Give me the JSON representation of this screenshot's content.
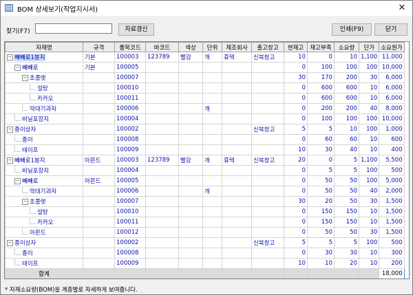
{
  "window": {
    "title": "BOM 상세보기(작업지시서)",
    "close_label": "✕"
  },
  "toolbar": {
    "find_label": "찾기(F7)",
    "search_value": "",
    "refresh_label": "자료갱신",
    "print_label": "인쇄(F9)",
    "close_label": "닫기"
  },
  "grid": {
    "columns": [
      "자재명",
      "규격",
      "품목코드",
      "바코드",
      "색상",
      "단위",
      "제조회사",
      "출고창고",
      "현재고",
      "재고부족",
      "소요량",
      "단가",
      "소요원가"
    ],
    "rows": [
      {
        "depth": 0,
        "exp": "-",
        "name": "빼빼로1봉지",
        "spec": "기본",
        "code": "100003",
        "barcode": "123789",
        "color": "빨강",
        "unit": "개",
        "maker": "휴텍",
        "warehouse": "신북창고",
        "stock": "10",
        "short": "0",
        "qty": "10",
        "price": "1,100",
        "cost": "11,000",
        "sel": true
      },
      {
        "depth": 1,
        "exp": "-",
        "name": "빼빼로",
        "spec": "기본",
        "code": "100005",
        "barcode": "",
        "color": "",
        "unit": "",
        "maker": "",
        "warehouse": "",
        "stock": "0",
        "short": "100",
        "qty": "100",
        "price": "100",
        "cost": "10,000"
      },
      {
        "depth": 2,
        "exp": "-",
        "name": "초콜렛",
        "spec": "",
        "code": "100007",
        "barcode": "",
        "color": "",
        "unit": "",
        "maker": "",
        "warehouse": "",
        "stock": "30",
        "short": "170",
        "qty": "200",
        "price": "30",
        "cost": "6,000"
      },
      {
        "depth": 3,
        "exp": "",
        "name": "설탕",
        "spec": "",
        "code": "100010",
        "barcode": "",
        "color": "",
        "unit": "",
        "maker": "",
        "warehouse": "",
        "stock": "0",
        "short": "600",
        "qty": "600",
        "price": "10",
        "cost": "6,000"
      },
      {
        "depth": 3,
        "exp": "",
        "name": "카카오",
        "spec": "",
        "code": "100011",
        "barcode": "",
        "color": "",
        "unit": "",
        "maker": "",
        "warehouse": "",
        "stock": "0",
        "short": "600",
        "qty": "600",
        "price": "10",
        "cost": "6,000"
      },
      {
        "depth": 2,
        "exp": "",
        "name": "막대기과자",
        "spec": "",
        "code": "100006",
        "barcode": "",
        "color": "",
        "unit": "개",
        "maker": "",
        "warehouse": "",
        "stock": "0",
        "short": "200",
        "qty": "200",
        "price": "40",
        "cost": "8,000"
      },
      {
        "depth": 1,
        "exp": "",
        "name": "비닐포장지",
        "spec": "",
        "code": "100004",
        "barcode": "",
        "color": "",
        "unit": "",
        "maker": "",
        "warehouse": "",
        "stock": "0",
        "short": "100",
        "qty": "100",
        "price": "100",
        "cost": "10,000"
      },
      {
        "depth": 0,
        "exp": "-",
        "name": "종이상자",
        "spec": "",
        "code": "100002",
        "barcode": "",
        "color": "",
        "unit": "",
        "maker": "",
        "warehouse": "신북창고",
        "stock": "5",
        "short": "5",
        "qty": "10",
        "price": "100",
        "cost": "1,000"
      },
      {
        "depth": 1,
        "exp": "",
        "name": "종이",
        "spec": "",
        "code": "100008",
        "barcode": "",
        "color": "",
        "unit": "",
        "maker": "",
        "warehouse": "",
        "stock": "0",
        "short": "60",
        "qty": "60",
        "price": "10",
        "cost": "600"
      },
      {
        "depth": 1,
        "exp": "",
        "name": "테이프",
        "spec": "",
        "code": "100009",
        "barcode": "",
        "color": "",
        "unit": "",
        "maker": "",
        "warehouse": "",
        "stock": "10",
        "short": "30",
        "qty": "40",
        "price": "10",
        "cost": "400"
      },
      {
        "depth": 0,
        "exp": "-",
        "name": "빼빼로1봉지",
        "spec": "아몬드",
        "code": "100003",
        "barcode": "123789",
        "color": "빨강",
        "unit": "개",
        "maker": "휴텍",
        "warehouse": "신북창고",
        "stock": "20",
        "short": "0",
        "qty": "5",
        "price": "1,100",
        "cost": "5,500"
      },
      {
        "depth": 1,
        "exp": "",
        "name": "비닐포장지",
        "spec": "",
        "code": "100004",
        "barcode": "",
        "color": "",
        "unit": "",
        "maker": "",
        "warehouse": "",
        "stock": "0",
        "short": "5",
        "qty": "5",
        "price": "100",
        "cost": "500"
      },
      {
        "depth": 1,
        "exp": "-",
        "name": "빼빼로",
        "spec": "아몬드",
        "code": "100005",
        "barcode": "",
        "color": "",
        "unit": "",
        "maker": "",
        "warehouse": "",
        "stock": "0",
        "short": "50",
        "qty": "50",
        "price": "100",
        "cost": "5,000"
      },
      {
        "depth": 2,
        "exp": "",
        "name": "막대기과자",
        "spec": "",
        "code": "100006",
        "barcode": "",
        "color": "",
        "unit": "개",
        "maker": "",
        "warehouse": "",
        "stock": "0",
        "short": "50",
        "qty": "50",
        "price": "40",
        "cost": "2,000"
      },
      {
        "depth": 2,
        "exp": "-",
        "name": "초콜렛",
        "spec": "",
        "code": "100007",
        "barcode": "",
        "color": "",
        "unit": "",
        "maker": "",
        "warehouse": "",
        "stock": "30",
        "short": "20",
        "qty": "50",
        "price": "30",
        "cost": "1,500"
      },
      {
        "depth": 3,
        "exp": "",
        "name": "설탕",
        "spec": "",
        "code": "100010",
        "barcode": "",
        "color": "",
        "unit": "",
        "maker": "",
        "warehouse": "",
        "stock": "0",
        "short": "150",
        "qty": "150",
        "price": "10",
        "cost": "1,500"
      },
      {
        "depth": 3,
        "exp": "",
        "name": "카카오",
        "spec": "",
        "code": "100011",
        "barcode": "",
        "color": "",
        "unit": "",
        "maker": "",
        "warehouse": "",
        "stock": "0",
        "short": "150",
        "qty": "150",
        "price": "10",
        "cost": "1,500"
      },
      {
        "depth": 2,
        "exp": "",
        "name": "아몬드",
        "spec": "",
        "code": "100012",
        "barcode": "",
        "color": "",
        "unit": "",
        "maker": "",
        "warehouse": "",
        "stock": "0",
        "short": "50",
        "qty": "50",
        "price": "30",
        "cost": "1,500"
      },
      {
        "depth": 0,
        "exp": "-",
        "name": "종이상자",
        "spec": "",
        "code": "100002",
        "barcode": "",
        "color": "",
        "unit": "",
        "maker": "",
        "warehouse": "신북창고",
        "stock": "5",
        "short": "5",
        "qty": "5",
        "price": "100",
        "cost": "500"
      },
      {
        "depth": 1,
        "exp": "",
        "name": "종이",
        "spec": "",
        "code": "100008",
        "barcode": "",
        "color": "",
        "unit": "",
        "maker": "",
        "warehouse": "",
        "stock": "0",
        "short": "30",
        "qty": "30",
        "price": "10",
        "cost": "300"
      },
      {
        "depth": 1,
        "exp": "",
        "name": "테이프",
        "spec": "",
        "code": "100009",
        "barcode": "",
        "color": "",
        "unit": "",
        "maker": "",
        "warehouse": "",
        "stock": "10",
        "short": "10",
        "qty": "20",
        "price": "10",
        "cost": "200"
      }
    ],
    "total_label": "합계",
    "total_value": "18,000"
  },
  "footer_hint": "* 자재소요량(BOM)을 계층별로 자세하게 보여줍니다.",
  "colors": {
    "text_blue": "#0b10a8",
    "selected_row": "#c9ddf5",
    "total_border": "#1aa0d8"
  }
}
